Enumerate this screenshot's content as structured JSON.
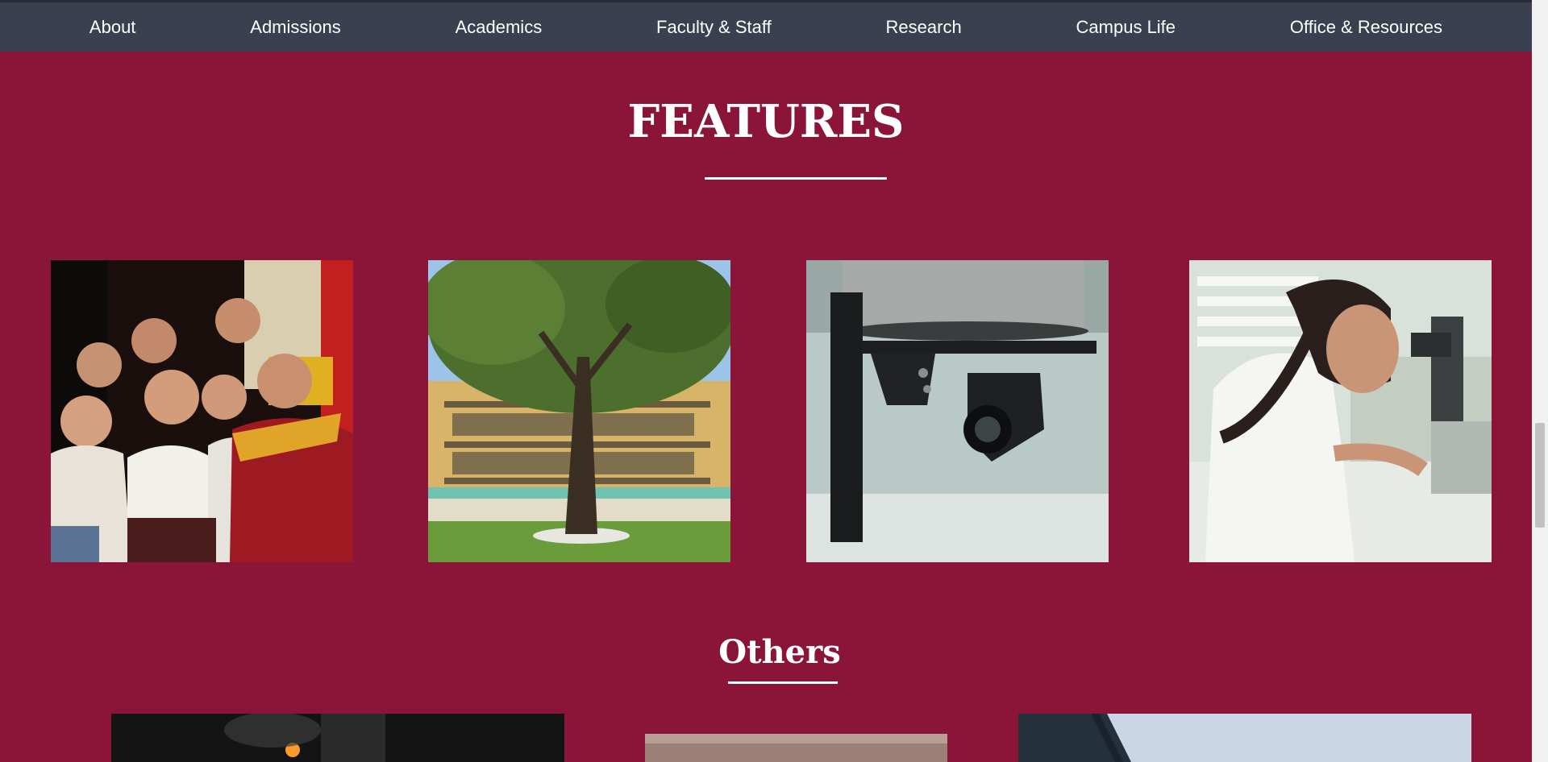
{
  "nav": {
    "items": [
      {
        "label": "About"
      },
      {
        "label": "Admissions"
      },
      {
        "label": "Academics"
      },
      {
        "label": "Faculty & Staff"
      },
      {
        "label": "Research"
      },
      {
        "label": "Campus Life"
      },
      {
        "label": "Office & Resources"
      }
    ]
  },
  "features": {
    "title": "FEATURES"
  },
  "others": {
    "title": "Others"
  },
  "colors": {
    "brand_maroon": "#8b1538",
    "nav_bg": "#3a4050",
    "text_white": "#ffffff"
  }
}
